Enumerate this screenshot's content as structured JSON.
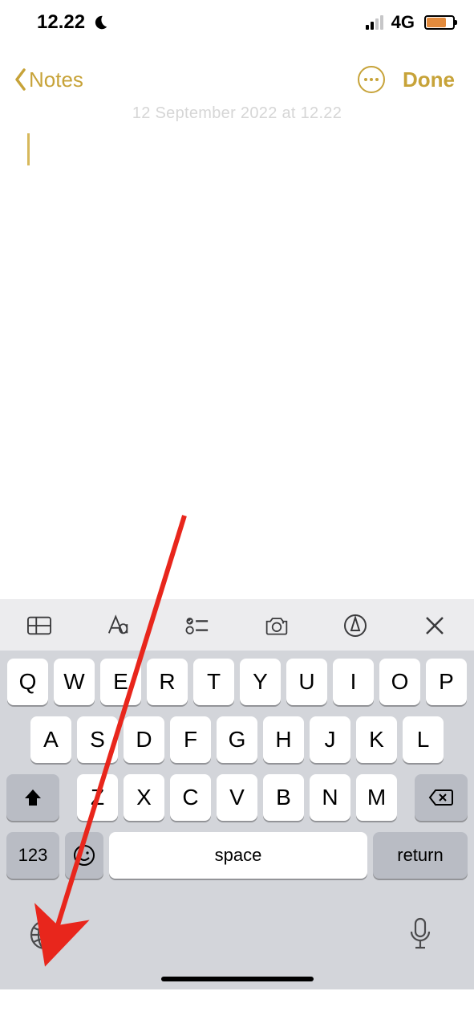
{
  "status": {
    "time": "12.22",
    "connection": "4G",
    "battery_color": "#e28a3c"
  },
  "nav": {
    "back_label": "Notes",
    "done_label": "Done"
  },
  "note": {
    "date": "12 September 2022 at 12.22"
  },
  "toolbar_icons": [
    "table",
    "format",
    "checklist",
    "camera",
    "markup",
    "close"
  ],
  "keyboard": {
    "row1": [
      "Q",
      "W",
      "E",
      "R",
      "T",
      "Y",
      "U",
      "I",
      "O",
      "P"
    ],
    "row2": [
      "A",
      "S",
      "D",
      "F",
      "G",
      "H",
      "J",
      "K",
      "L"
    ],
    "row3": [
      "Z",
      "X",
      "C",
      "V",
      "B",
      "N",
      "M"
    ],
    "numeric_label": "123",
    "space_label": "space",
    "return_label": "return"
  },
  "annotation": {
    "arrow_color": "#e8261c"
  }
}
